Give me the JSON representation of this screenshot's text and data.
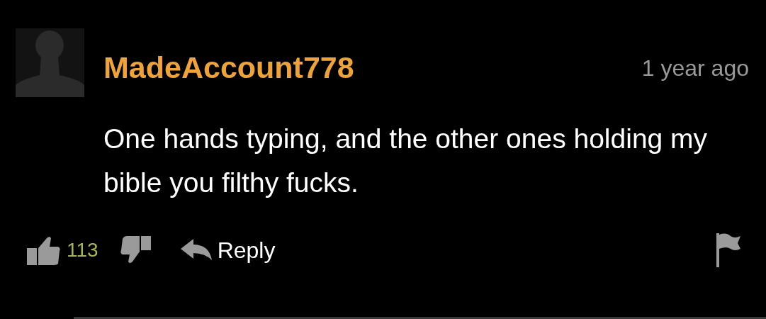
{
  "comment": {
    "username": "MadeAccount778",
    "time": "1 year ago",
    "text": "One hands typing, and the other ones holding my bible you filthy fucks.",
    "likes": "113",
    "reply_label": "Reply"
  }
}
